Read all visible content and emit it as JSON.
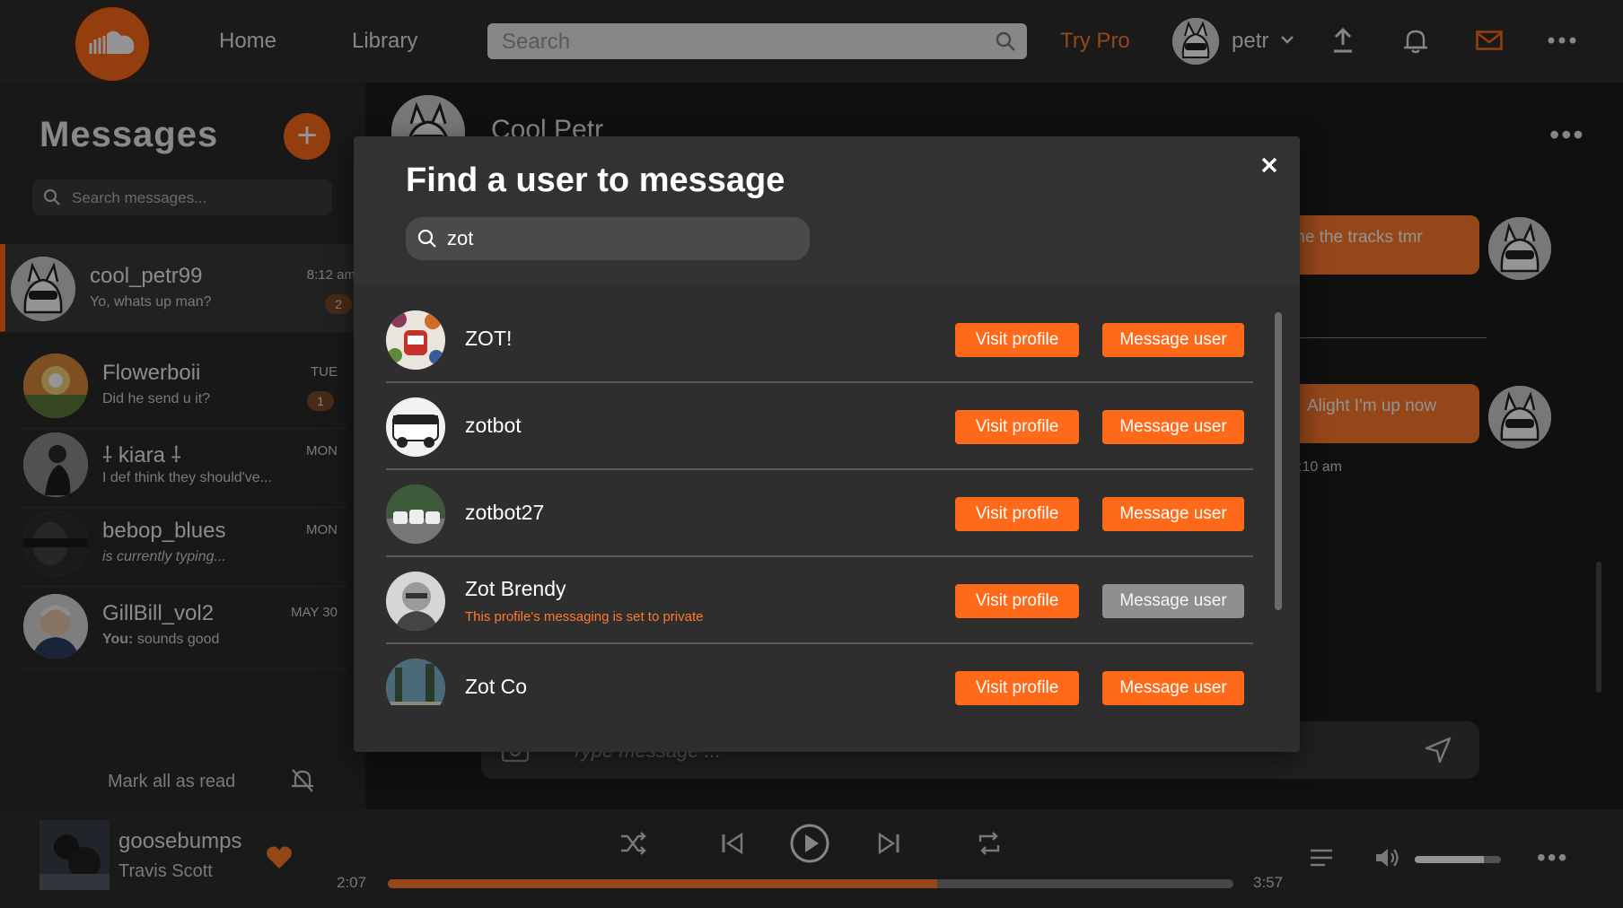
{
  "colors": {
    "accent": "#ff6a1a",
    "bg": "#2a2a2a",
    "disabled": "#8f8f8f"
  },
  "topbar": {
    "nav": [
      {
        "label": "Home"
      },
      {
        "label": "Library"
      }
    ],
    "search_placeholder": "Search",
    "try_pro": "Try Pro",
    "username": "petr"
  },
  "sidebar": {
    "title": "Messages",
    "search_placeholder": "Search messages...",
    "conversations": [
      {
        "name": "cool_petr99",
        "preview": "Yo, whats up man?",
        "time": "8:12 am",
        "badge": "2"
      },
      {
        "name": "Flowerboii",
        "preview": "Did he send u it?",
        "time": "TUE",
        "badge": "1"
      },
      {
        "name": "⸸ kiara ⸸",
        "preview": "I def think they should've...",
        "time": "MON",
        "badge": ""
      },
      {
        "name": "bebop_blues",
        "preview": "is currently typing...",
        "time": "MON",
        "badge": ""
      },
      {
        "name": "GillBill_vol2",
        "preview_prefix": "You:",
        "preview": "sounds good",
        "time": "MAY 30",
        "badge": ""
      }
    ],
    "mark_all_read": "Mark all as read"
  },
  "chat": {
    "header_name": "Cool Petr",
    "messages": [
      {
        "text": "me the tracks tmr"
      },
      {
        "text": "Alight I'm up now"
      }
    ],
    "timestamp": ":10 am",
    "composer_placeholder": "Type message ..."
  },
  "modal": {
    "title": "Find a user to message",
    "search_value": "zot",
    "visit_label": "Visit profile",
    "message_label": "Message user",
    "results": [
      {
        "name": "ZOT!",
        "note": "",
        "can_message": true
      },
      {
        "name": "zotbot",
        "note": "",
        "can_message": true
      },
      {
        "name": "zotbot27",
        "note": "",
        "can_message": true
      },
      {
        "name": "Zot Brendy",
        "note": "This profile's messaging is set to private",
        "can_message": false
      },
      {
        "name": "Zot Co",
        "note": "",
        "can_message": true
      }
    ]
  },
  "player": {
    "track": "goosebumps",
    "artist": "Travis Scott",
    "elapsed": "2:07",
    "duration": "3:57",
    "progress": 0.65,
    "volume": 0.8
  }
}
